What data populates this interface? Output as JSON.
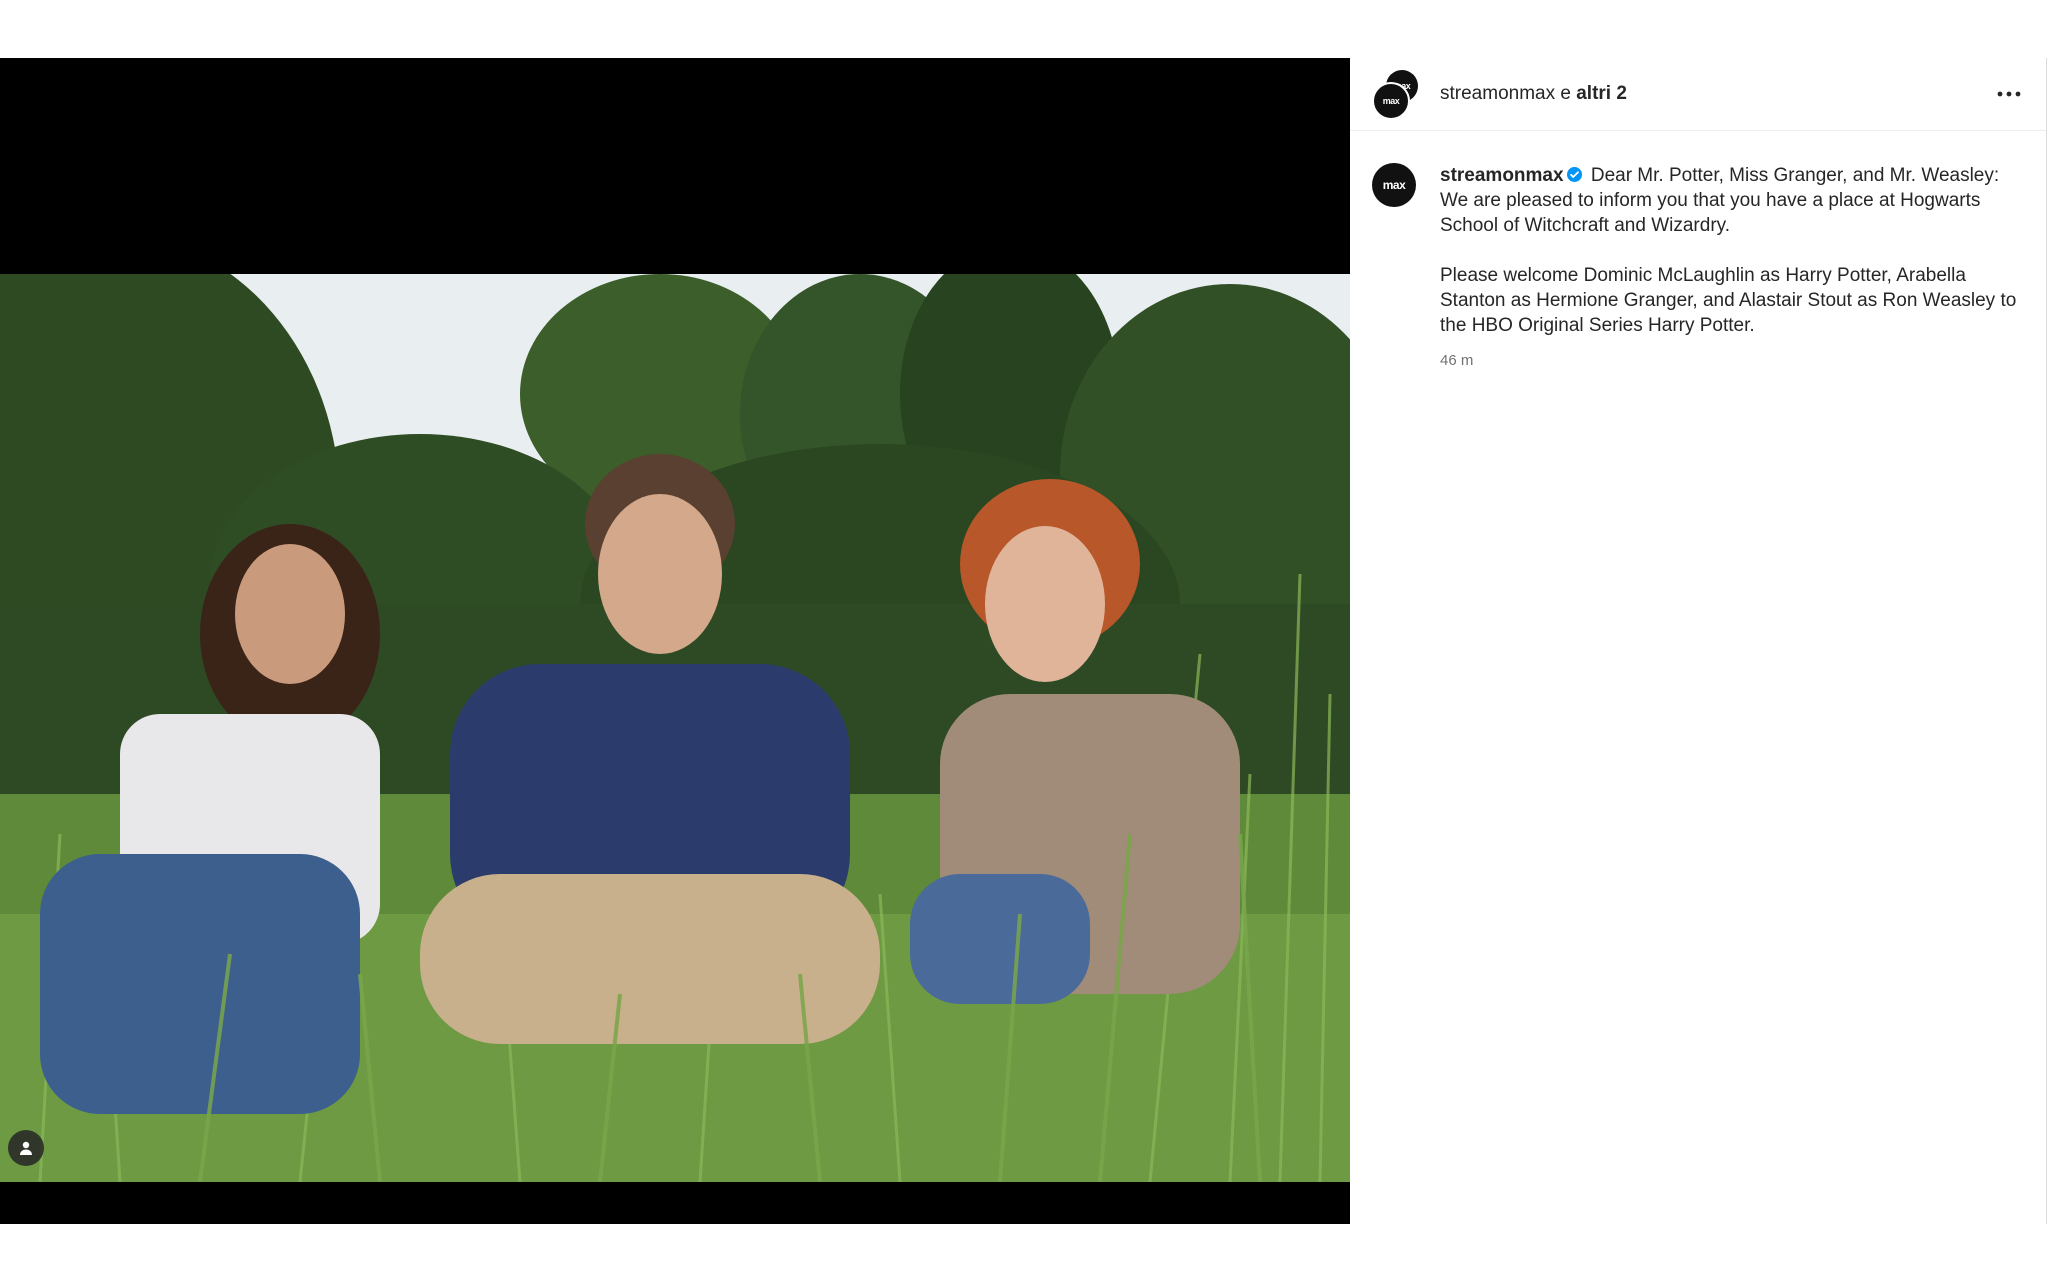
{
  "header": {
    "username": "streamonmax",
    "joiner": " e ",
    "others": "altri 2",
    "more_icon": "more-horizontal-icon"
  },
  "avatar": {
    "text": "max",
    "background": "#111111"
  },
  "media": {
    "tag_icon": "user-tag-icon",
    "description": "three kids crouching in tall grass"
  },
  "caption": {
    "username": "streamonmax",
    "verified_icon": "verified-badge-icon",
    "paragraph1": "Dear Mr. Potter, Miss Granger, and Mr. Weasley: We are pleased to inform you that you have a place at Hogwarts School of Witchcraft and Wizardry.",
    "paragraph2": "Please welcome Dominic McLaughlin as Harry Potter, Arabella Stanton as Hermione Granger, and Alastair Stout as Ron Weasley to the HBO Original Series Harry Potter.",
    "time": "46 m"
  },
  "colors": {
    "accent": "#0095f6",
    "text": "#262626",
    "muted": "#737373"
  }
}
